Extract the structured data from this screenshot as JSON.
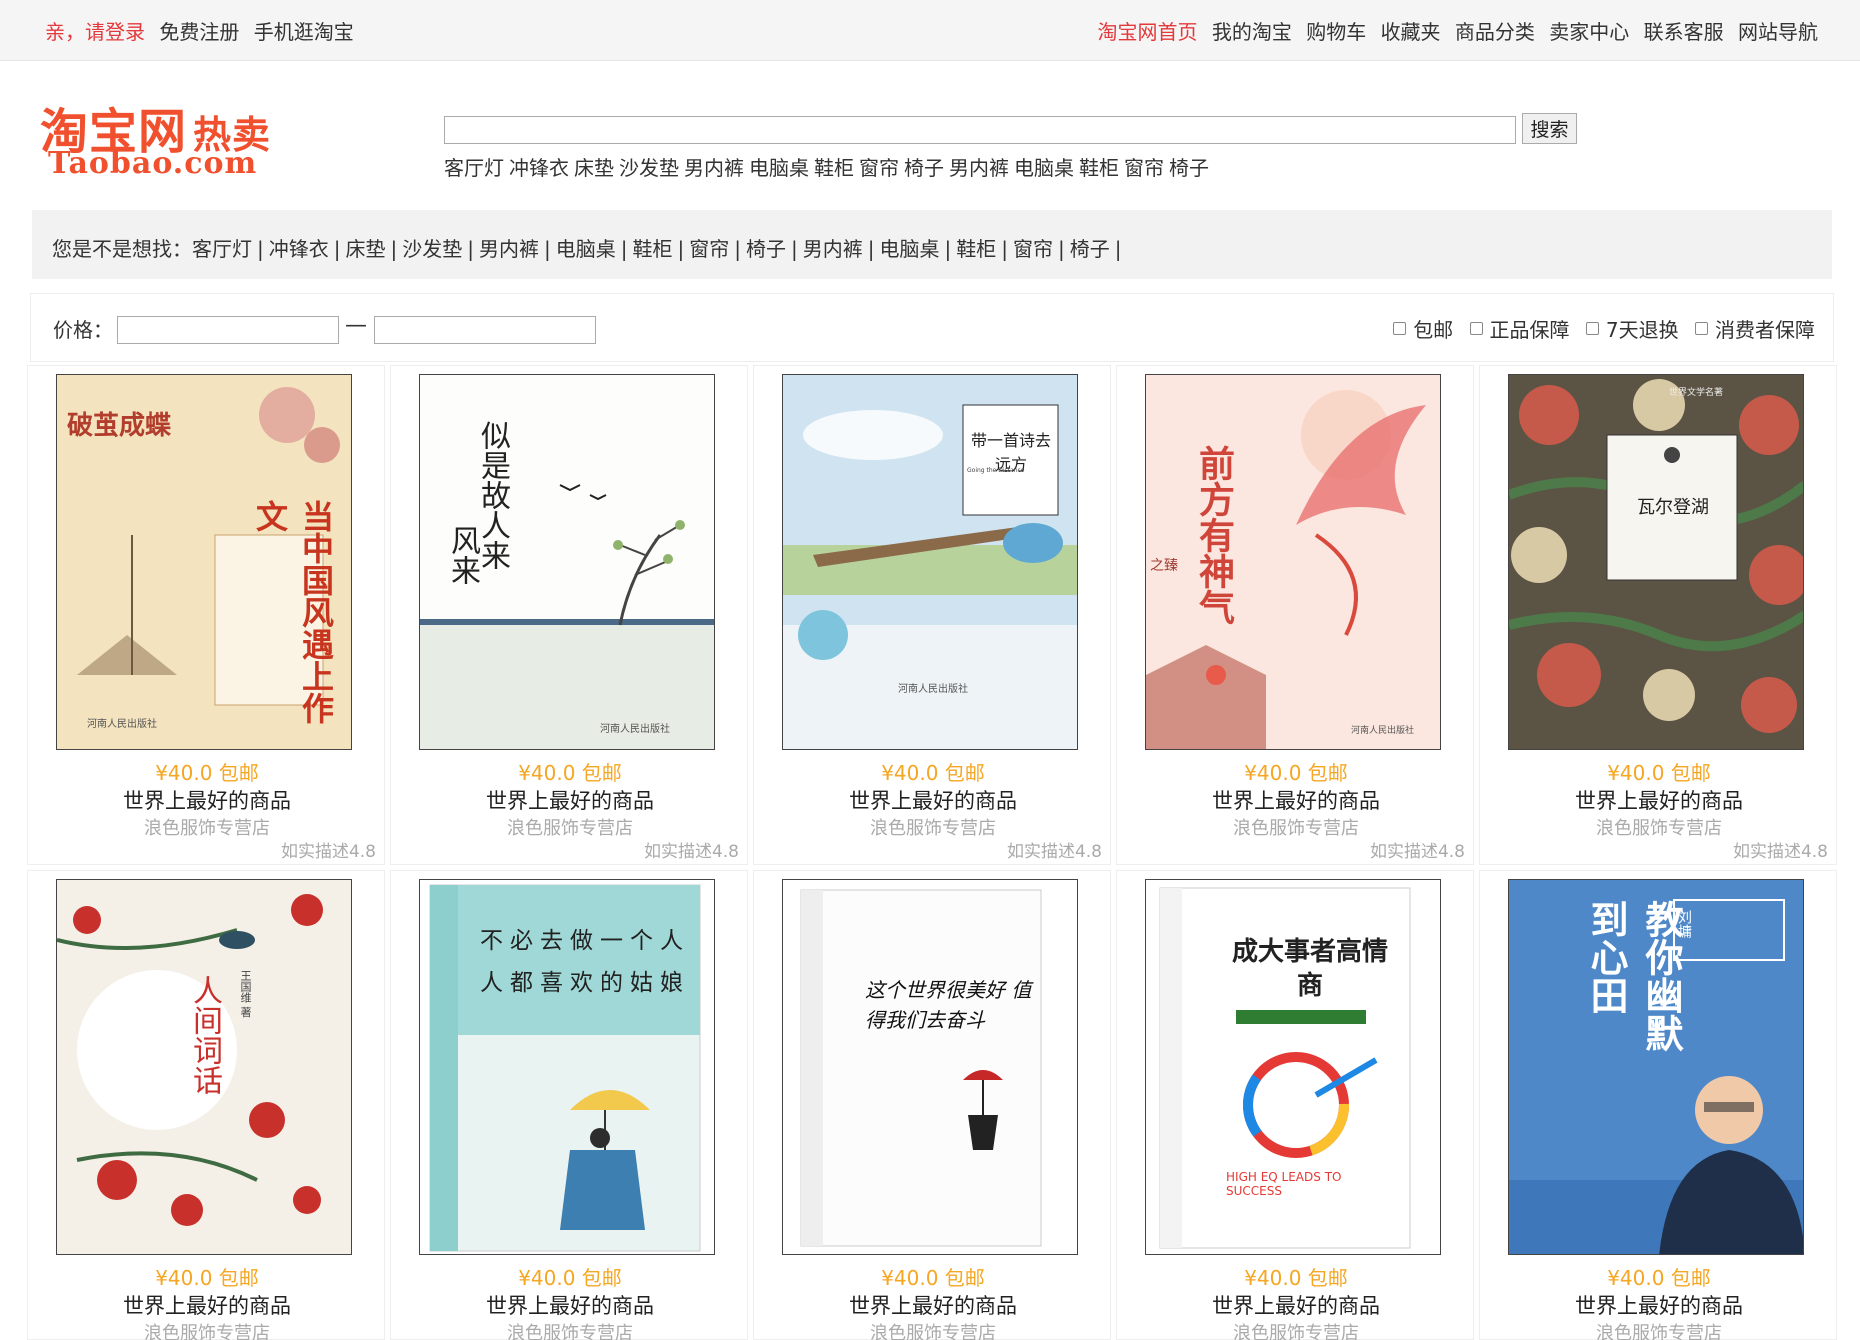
{
  "topbar": {
    "login": "亲，请登录",
    "register": "免费注册",
    "mobile": "手机逛淘宝",
    "links": [
      "淘宝网首页",
      "我的淘宝",
      "购物车",
      "收藏夹",
      "商品分类",
      "卖家中心",
      "联系客服",
      "网站导航"
    ]
  },
  "logo": {
    "cn": "淘宝网",
    "hot": "热卖",
    "en": "Taobao.com"
  },
  "search": {
    "value": "",
    "button": "搜索"
  },
  "hot_words": [
    "客厅灯",
    "冲锋衣",
    "床垫",
    "沙发垫",
    "男内裤",
    "电脑桌",
    "鞋柜",
    "窗帘",
    "椅子",
    "男内裤",
    "电脑桌",
    "鞋柜",
    "窗帘",
    "椅子"
  ],
  "suggest": {
    "label": "您是不是想找：",
    "items": [
      "客厅灯",
      "冲锋衣",
      "床垫",
      "沙发垫",
      "男内裤",
      "电脑桌",
      "鞋柜",
      "窗帘",
      "椅子",
      "男内裤",
      "电脑桌",
      "鞋柜",
      "窗帘",
      "椅子"
    ]
  },
  "filter": {
    "price_label": "价格：",
    "dash": "—",
    "checks": [
      "包邮",
      "正品保障",
      "7天退换",
      "消费者保障"
    ]
  },
  "products": [
    {
      "price": "¥40.0 包邮",
      "title": "世界上最好的商品",
      "shop": "浪色服饰专营店",
      "rating": "如实描述4.8",
      "cover_title": "当中国风遇上作文",
      "cover_sub": "破茧成蝶",
      "cover_pub": "河南人民出版社"
    },
    {
      "price": "¥40.0 包邮",
      "title": "世界上最好的商品",
      "shop": "浪色服饰专营店",
      "rating": "如实描述4.8",
      "cover_title": "似是故人来",
      "cover_sub": "风来",
      "cover_pub": "河南人民出版社"
    },
    {
      "price": "¥40.0 包邮",
      "title": "世界上最好的商品",
      "shop": "浪色服饰专营店",
      "rating": "如实描述4.8",
      "cover_title": "带一首诗去远方",
      "cover_sub": "Going the Distance",
      "cover_pub": "河南人民出版社"
    },
    {
      "price": "¥40.0 包邮",
      "title": "世界上最好的商品",
      "shop": "浪色服饰专营店",
      "rating": "如实描述4.8",
      "cover_title": "前方有神气",
      "cover_sub": "之臻",
      "cover_pub": "河南人民出版社"
    },
    {
      "price": "¥40.0 包邮",
      "title": "世界上最好的商品",
      "shop": "浪色服饰专营店",
      "rating": "如实描述4.8",
      "cover_title": "瓦尔登湖",
      "cover_sub": "世界文学名著",
      "cover_pub": ""
    },
    {
      "price": "¥40.0 包邮",
      "title": "世界上最好的商品",
      "shop": "浪色服饰专营店",
      "rating": "",
      "cover_title": "人间词话",
      "cover_sub": "王国维 著",
      "cover_pub": ""
    },
    {
      "price": "¥40.0 包邮",
      "title": "世界上最好的商品",
      "shop": "浪色服饰专营店",
      "rating": "",
      "cover_title": "不必去做一个人人都喜欢的姑娘",
      "cover_sub": "",
      "cover_pub": ""
    },
    {
      "price": "¥40.0 包邮",
      "title": "世界上最好的商品",
      "shop": "浪色服饰专营店",
      "rating": "",
      "cover_title": "这个世界很美好 值得我们去奋斗",
      "cover_sub": "",
      "cover_pub": ""
    },
    {
      "price": "¥40.0 包邮",
      "title": "世界上最好的商品",
      "shop": "浪色服饰专营店",
      "rating": "",
      "cover_title": "成大事者高情商",
      "cover_sub": "HIGH EQ LEADS TO SUCCESS",
      "cover_pub": ""
    },
    {
      "price": "¥40.0 包邮",
      "title": "世界上最好的商品",
      "shop": "浪色服饰专营店",
      "rating": "",
      "cover_title": "教你幽默到心田",
      "cover_sub": "刘墉",
      "cover_pub": ""
    }
  ],
  "colors": {
    "accent": "#e4393c",
    "price": "#f5a623",
    "logo": "#f0502d"
  }
}
